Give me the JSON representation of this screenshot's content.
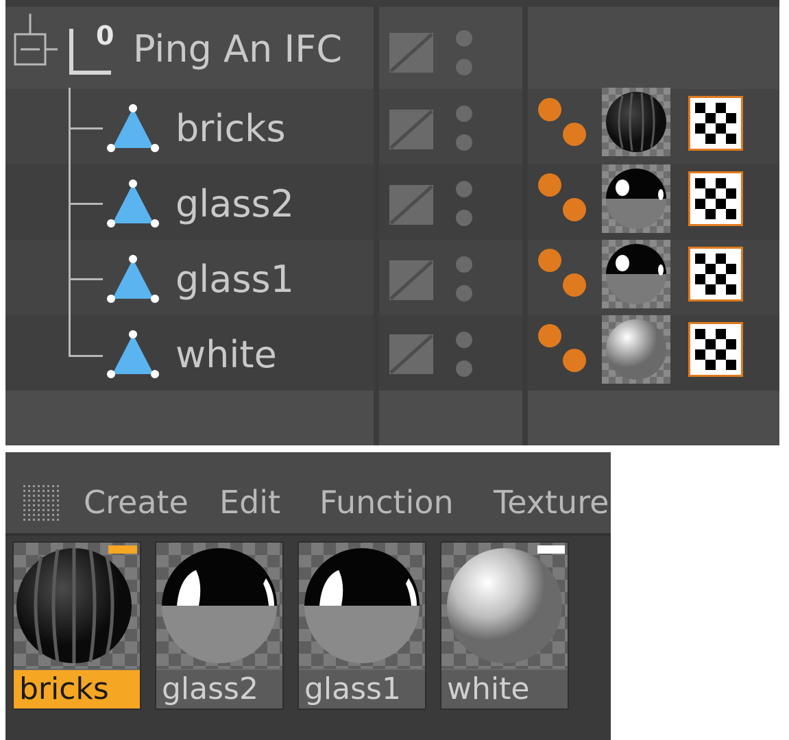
{
  "object_manager": {
    "null_object": {
      "name": "Ping An IFC",
      "badge": "0"
    },
    "children": [
      {
        "name": "bricks"
      },
      {
        "name": "glass2"
      },
      {
        "name": "glass1"
      },
      {
        "name": "white"
      }
    ],
    "colors": {
      "background": "#4d4d4d",
      "text": "#c9c9c9",
      "tag_orange": "#e07a1f",
      "poly_icon": "#5ab4f0"
    }
  },
  "material_manager": {
    "menu": {
      "create": "Create",
      "edit": "Edit",
      "function": "Function",
      "texture": "Texture"
    },
    "materials": [
      {
        "name": "bricks",
        "selected": true
      },
      {
        "name": "glass2",
        "selected": false
      },
      {
        "name": "glass1",
        "selected": false
      },
      {
        "name": "white",
        "selected": false
      }
    ],
    "colors": {
      "selected_label": "#f5a623"
    }
  }
}
